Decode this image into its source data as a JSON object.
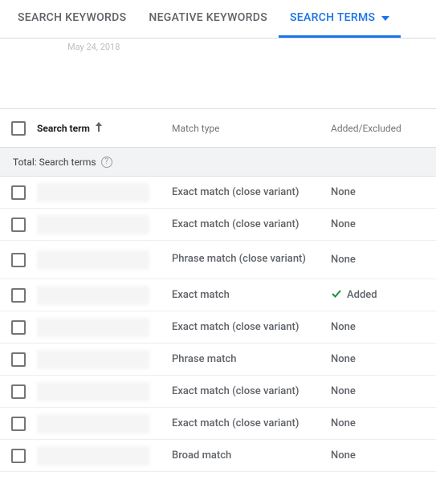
{
  "tabs": {
    "search_keywords": "SEARCH KEYWORDS",
    "negative_keywords": "NEGATIVE KEYWORDS",
    "search_terms": "SEARCH TERMS"
  },
  "date_text": "May 24, 2018",
  "columns": {
    "search_term": "Search term",
    "match_type": "Match type",
    "added_excluded": "Added/Excluded"
  },
  "total_row_label": "Total: Search terms",
  "added_label": "Added",
  "rows": [
    {
      "match_type": "Exact match (close variant)",
      "added": "None"
    },
    {
      "match_type": "Exact match (close variant)",
      "added": "None"
    },
    {
      "match_type": "Phrase match (close variant)",
      "added": "None",
      "wrap": true
    },
    {
      "match_type": "Exact match",
      "added": "Added",
      "added_icon": true
    },
    {
      "match_type": "Exact match (close variant)",
      "added": "None"
    },
    {
      "match_type": "Phrase match",
      "added": "None"
    },
    {
      "match_type": "Exact match (close variant)",
      "added": "None"
    },
    {
      "match_type": "Exact match (close variant)",
      "added": "None"
    },
    {
      "match_type": "Broad match",
      "added": "None"
    }
  ]
}
